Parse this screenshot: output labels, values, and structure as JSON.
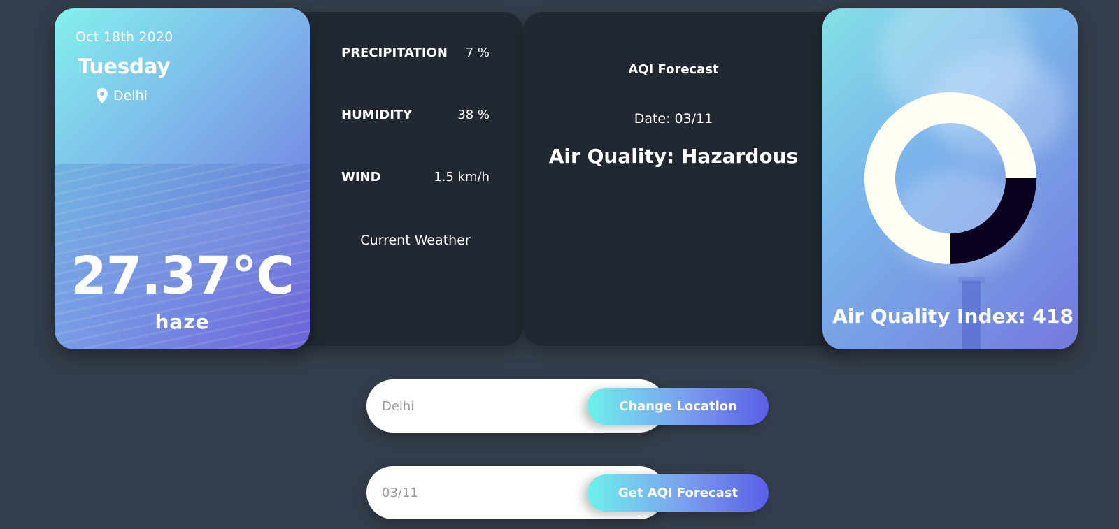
{
  "weather_card": {
    "date": "Oct 18th 2020",
    "day": "Tuesday",
    "location": "Delhi",
    "location_icon": "map-pin-icon",
    "temperature": "27.37°C",
    "description": "haze"
  },
  "weather_info": {
    "rows": [
      {
        "label": "PRECIPITATION",
        "value": "7 %"
      },
      {
        "label": "HUMIDITY",
        "value": "38 %"
      },
      {
        "label": "WIND",
        "value": "1.5 km/h"
      }
    ],
    "footer": "Current Weather"
  },
  "aqi_panel": {
    "title": "AQI Forecast",
    "date": "Date: 03/11",
    "quality": "Air Quality: Hazardous"
  },
  "aqi_card": {
    "index_text": "Air Quality Index: 418",
    "gauge_fraction": 0.25,
    "gauge_fill_color": "#0b0020",
    "gauge_track_color": "#fffef3"
  },
  "location_form": {
    "value": "Delhi",
    "button_label": "Change Location"
  },
  "forecast_form": {
    "value": "03/11",
    "button_label": "Get AQI Forecast"
  },
  "colors": {
    "background": "#343d4b",
    "panel": "#222831",
    "accent_start": "#6ef0ec",
    "accent_end": "#5b5fe6"
  }
}
